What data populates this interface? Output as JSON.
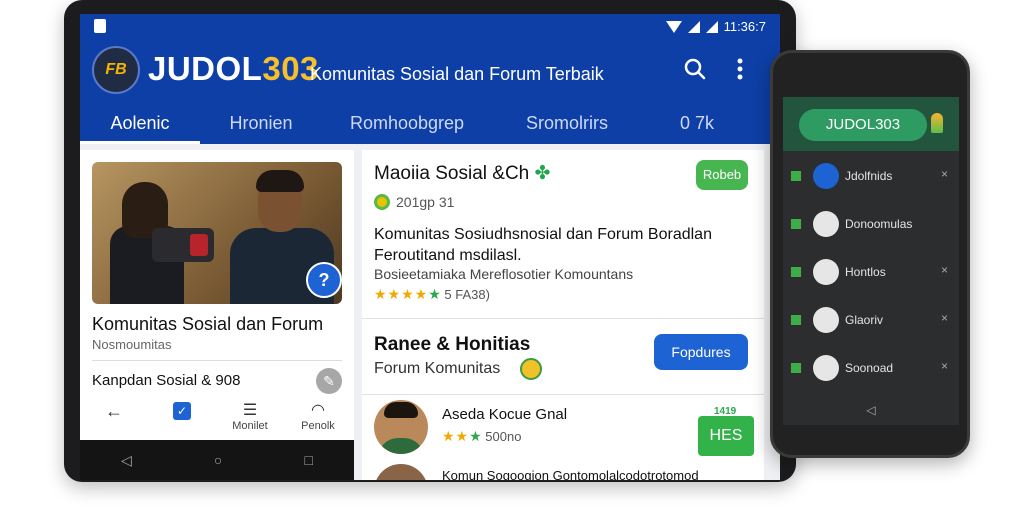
{
  "tablet": {
    "status_time": "11:36:7",
    "brand_word": "JUDOL",
    "brand_num": "303",
    "logo_text": "FB",
    "tagline": "Komunitas Sosial dan Forum Terbaik",
    "tabs": [
      "Aolenic",
      "Hronien",
      "Romhoobgrep",
      "Sromolrirs",
      "0 7k"
    ],
    "left_card": {
      "title": "Komunitas Sosial dan Forum",
      "subtitle": "Nosmoumitas",
      "row": "Kanpdan Sosial & 908",
      "nav": [
        "",
        "",
        "Monilet",
        "Penolk"
      ]
    },
    "right": {
      "title": "Maoiia Sosial &Ch",
      "green_button": "Robeb",
      "meta": "201gp   31",
      "desc": "Komunitas Sosiudhsnosial dan Forum Boradlan Feroutitand msdilasl.",
      "desc2": "Bosieetamiaka Mereflosotier Komountans",
      "rating": "5 FA38)",
      "section_title": "Ranee & Honitias",
      "section_sub": "Forum Komunitas",
      "blue_button": "Fopdures",
      "user_name": "Aseda Kocue Gnal",
      "user_rating": "500no",
      "user_badge": "1419",
      "hes_button": "HES",
      "last_line": "Komun Sogoogion Gontomolalcodotrotomod"
    }
  },
  "phone": {
    "header": "JUDOL303",
    "items": [
      {
        "label": "Jdolfnids",
        "x": "×"
      },
      {
        "label": "Donoomulas",
        "x": ""
      },
      {
        "label": "Hontlos",
        "x": "×"
      },
      {
        "label": "Glaoriv",
        "x": "×"
      },
      {
        "label": "Soonoad",
        "x": "×"
      }
    ],
    "nav": "◁"
  },
  "colors": {
    "primary": "#0d3fa6",
    "accent": "#f7c02b",
    "green": "#34b24a",
    "blue_button": "#1d63d3"
  }
}
